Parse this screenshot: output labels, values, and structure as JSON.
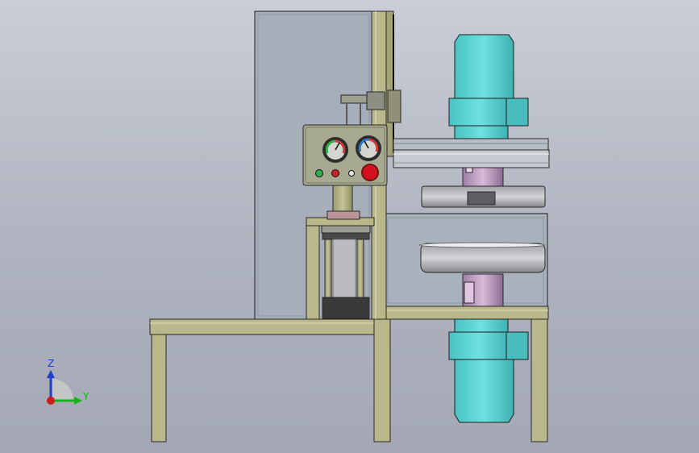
{
  "viewport": {
    "background_top": "#c9ced8",
    "background_bottom": "#a3a8b4"
  },
  "model": {
    "frame_color": "#b8b88a",
    "motor_color": "#55cfcf",
    "guard_color": "#a5adb9",
    "control_panel": {
      "panel_color": "#a6a890",
      "lamp_colors": [
        "#2bb24c",
        "#cc1e2b",
        "#e4e4e4"
      ],
      "emergency_stop_color": "#d4121e"
    }
  },
  "triad": {
    "z_label": "Z",
    "y_label": "Y",
    "z_color": "#1f3fd0",
    "y_color": "#19b319",
    "x_color": "#d11a1a"
  }
}
